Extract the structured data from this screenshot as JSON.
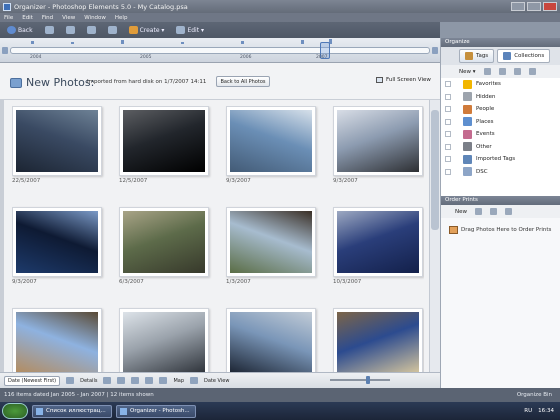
{
  "window": {
    "title": "Organizer - Photoshop Elements 5.0 - My Catalog.psa"
  },
  "menu": [
    "File",
    "Edit",
    "Find",
    "View",
    "Window",
    "Help"
  ],
  "toolbar": {
    "back": "Back",
    "create": "Create ▾",
    "edit": "Edit ▾"
  },
  "timeline": {
    "years": [
      "2004",
      "2005",
      "2006",
      "2007"
    ]
  },
  "header": {
    "title": "New Photos:",
    "subtitle": "Imported from hard disk on 1/7/2007 14:11",
    "back_all": "Back to All Photos",
    "full_screen": "Full Screen View"
  },
  "photos": [
    {
      "date": "22/5/2007",
      "palette": [
        "#3a4a63",
        "#1c2533",
        "#6e8296"
      ]
    },
    {
      "date": "12/5/2007",
      "palette": [
        "#22262c",
        "#000",
        "#5c5e62"
      ]
    },
    {
      "date": "9/3/2007",
      "palette": [
        "#6b8fb6",
        "#435b76",
        "#d6e0ea"
      ]
    },
    {
      "date": "9/3/2007",
      "palette": [
        "#8c9bb0",
        "#2d2f33",
        "#d8dde6"
      ]
    },
    {
      "date": "9/3/2007",
      "palette": [
        "#0e1a33",
        "#1d3a6b",
        "#7b9ac7"
      ]
    },
    {
      "date": "6/3/2007",
      "palette": [
        "#5d6b4a",
        "#37392b",
        "#a9a487"
      ]
    },
    {
      "date": "1/3/2007",
      "palette": [
        "#a7bccf",
        "#5a6d45",
        "#3a2f26"
      ]
    },
    {
      "date": "10/3/2007",
      "palette": [
        "#2a3e7a",
        "#13204a",
        "#9da9c2"
      ]
    },
    {
      "date": "",
      "palette": [
        "#8eb2e0",
        "#b48b5c",
        "#5a4a35"
      ]
    },
    {
      "date": "",
      "palette": [
        "#9aa2ab",
        "#2c3138",
        "#dde3e9"
      ]
    },
    {
      "date": "",
      "palette": [
        "#7a96b8",
        "#1a2230",
        "#c2ccd7"
      ]
    },
    {
      "date": "",
      "palette": [
        "#2c4b8f",
        "#d8c89e",
        "#7c6548"
      ]
    }
  ],
  "bottombar": {
    "sort": "Date (Newest First)",
    "details": "Details",
    "map": "Map",
    "date_view": "Date View"
  },
  "status": {
    "left": "116 items dated Jan 2005 - Jan 2007 | 12 items shown",
    "right": "Organize Bin"
  },
  "rpanel": {
    "header": "Organize",
    "tab_tags": "Tags",
    "tab_collections": "Collections",
    "new": "New ▾",
    "tags": [
      {
        "label": "Favorites",
        "color": "#f2b600"
      },
      {
        "label": "Hidden",
        "color": "#9da4ad"
      },
      {
        "label": "People",
        "color": "#d07b3a"
      },
      {
        "label": "Places",
        "color": "#5e8fcf"
      },
      {
        "label": "Events",
        "color": "#c46b8f"
      },
      {
        "label": "Other",
        "color": "#7b7f88"
      },
      {
        "label": "Imported Tags",
        "color": "#5f86b8"
      },
      {
        "label": "DSC",
        "color": "#8da5c7"
      }
    ],
    "order_header": "Order Prints",
    "order_new": "New",
    "order_drop": "Drag Photos Here to Order Prints"
  },
  "taskbar": {
    "task1": "Список иллюстрац...",
    "task2": "Organizer - Photosh...",
    "lang": "RU",
    "time": "16:34"
  }
}
